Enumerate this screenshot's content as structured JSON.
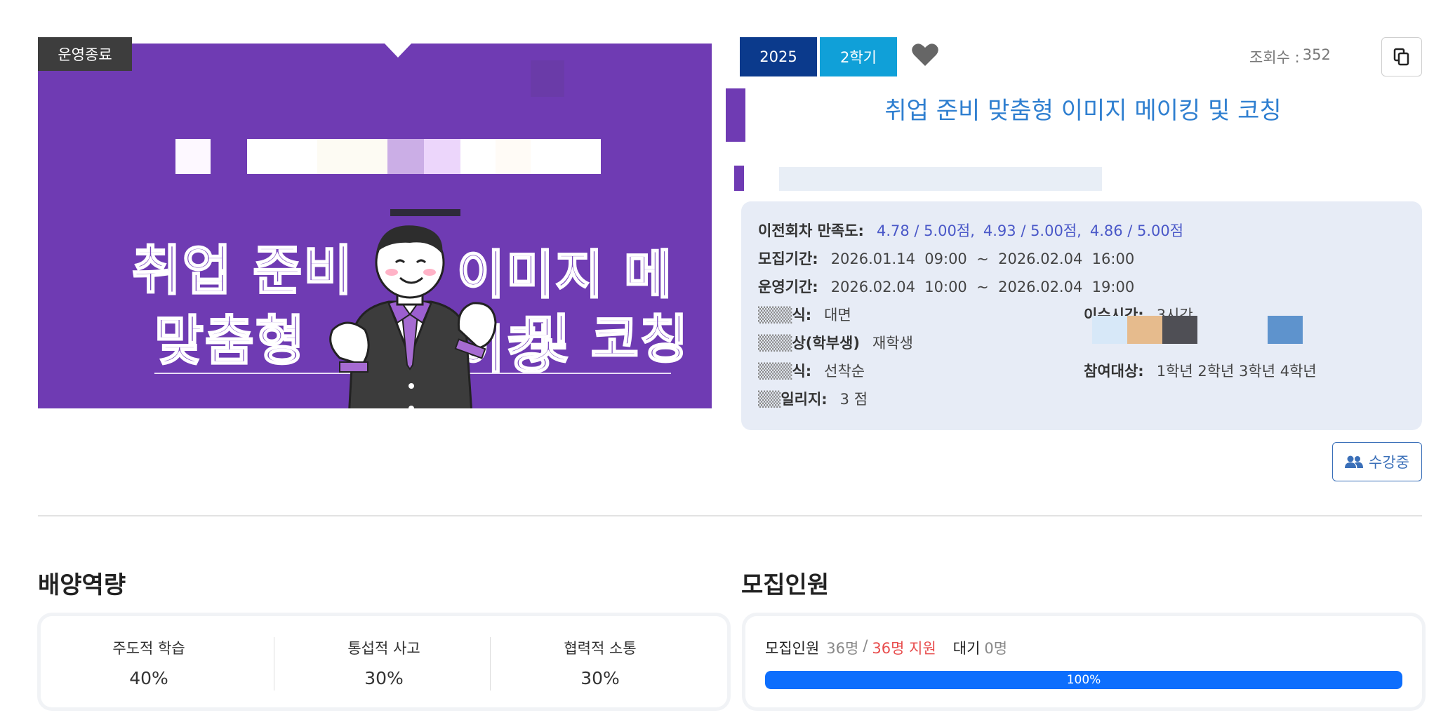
{
  "banner": {
    "status_tag": "운영종료",
    "title_line1a": "취업 준비",
    "title_line1b": "이미지 메이킹",
    "title_line2a": "맞춤형",
    "title_line2b": "및 코칭"
  },
  "badges": {
    "year": "2025",
    "semester": "2학기"
  },
  "views": {
    "label": "조회수 :",
    "count": "352"
  },
  "course_title": "취업 준비 맞춤형 이미지 메이킹 및 코칭",
  "info": {
    "satisfaction_label": "이전회차 만족도:",
    "satisfaction_values": [
      "4.78 / 5.00점,",
      "4.93 / 5.00점,",
      "4.86 / 5.00점"
    ],
    "recruit_label": "모집기간:",
    "recruit_value": "2026.01.14  09:00  ~  2026.02.04  16:00",
    "operate_label": "운영기간:",
    "operate_value": "2026.02.04  10:00  ~  2026.02.04  19:00",
    "method_label": "식:",
    "method_value": "대면",
    "hours_label": "이수시간:",
    "hours_value": "3시간",
    "target_label": "상(학부생)",
    "target_value": "재학생",
    "select_label": "식:",
    "select_value": "선착순",
    "grade_label": "참여대상:",
    "grade_value": "1학년 2학년 3학년 4학년",
    "mileage_label": "일리지:",
    "mileage_value": "3 점"
  },
  "enrolled_button": "수강중",
  "competency": {
    "title": "배양역량",
    "items": [
      {
        "name": "주도적 학습",
        "percent": "40%"
      },
      {
        "name": "통섭적 사고",
        "percent": "30%"
      },
      {
        "name": "협력적 소통",
        "percent": "30%"
      }
    ]
  },
  "recruitment": {
    "title": "모집인원",
    "label": "모집인원",
    "capacity": "36명",
    "slash": "/",
    "applied": "36명 지원",
    "waiting_label": "대기",
    "waiting_value": "0명",
    "progress_label": "100%",
    "progress_fraction": 1.0
  },
  "colors": {
    "banner_purple": "#6f3bb3",
    "year_badge": "#0b3a8c",
    "semester_badge": "#10a0d8",
    "title_blue": "#2f7fd0",
    "progress_blue": "#0d6efd",
    "applied_red": "#e84d4d"
  }
}
